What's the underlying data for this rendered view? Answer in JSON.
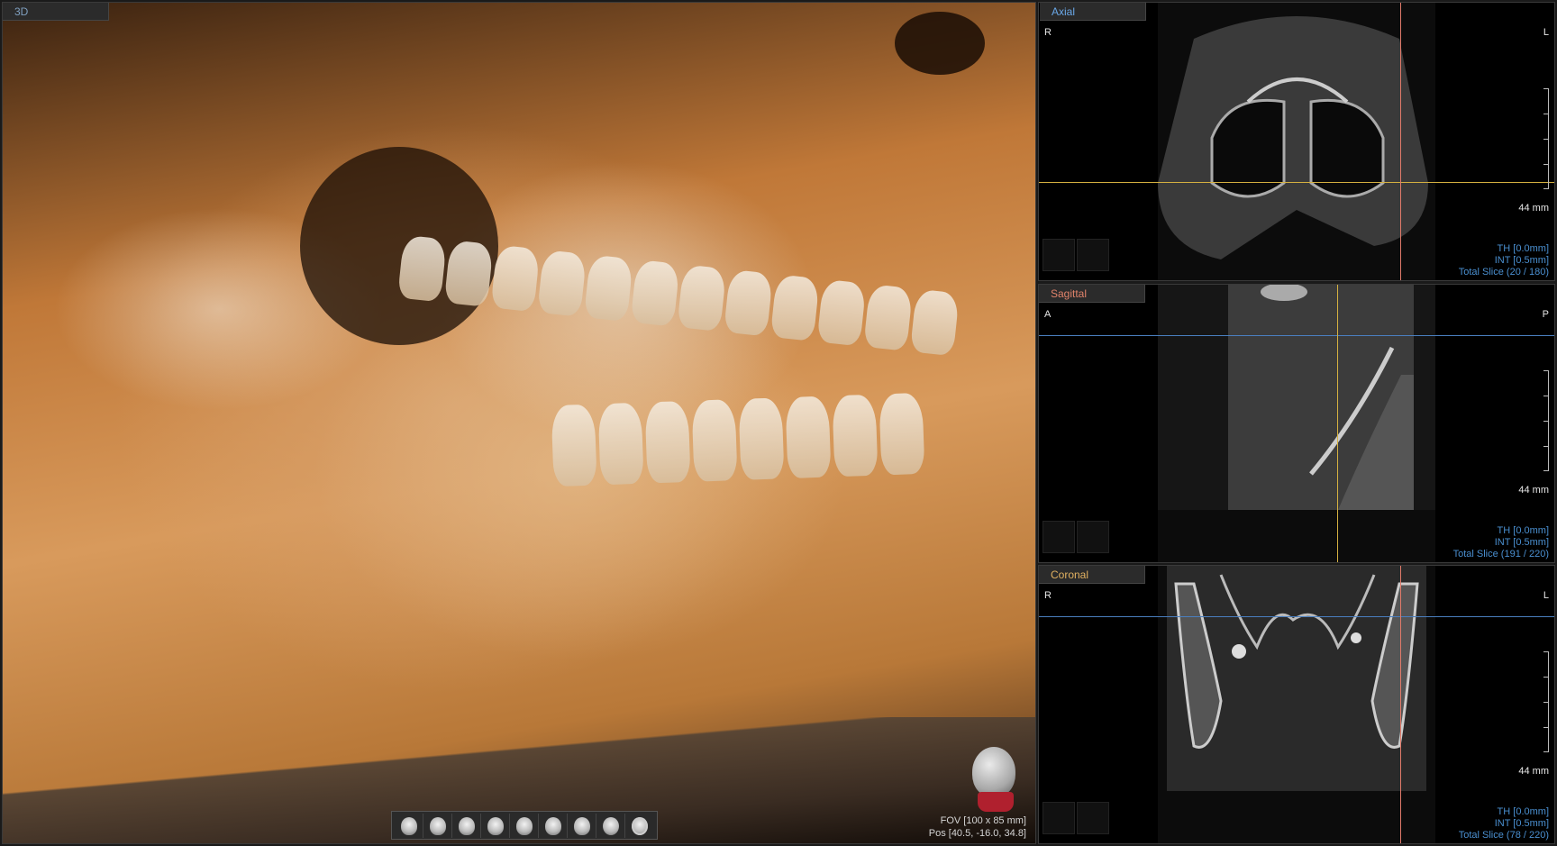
{
  "views": {
    "v3d": {
      "label": "3D",
      "fov_line": "FOV [100 x 85 mm]",
      "pos_line": "Pos [40.5, -16.0, 34.8]"
    },
    "axial": {
      "label": "Axial",
      "left": "R",
      "right": "L",
      "scale": "44 mm",
      "th": "TH [0.0mm]",
      "int": "INT [0.5mm]",
      "total": "Total Slice (20 / 180)"
    },
    "sagittal": {
      "label": "Sagittal",
      "left": "A",
      "right": "P",
      "scale": "44 mm",
      "th": "TH [0.0mm]",
      "int": "INT [0.5mm]",
      "total": "Total Slice (191 / 220)"
    },
    "coronal": {
      "label": "Coronal",
      "left": "R",
      "right": "L",
      "scale": "44 mm",
      "th": "TH [0.0mm]",
      "int": "INT [0.5mm]",
      "total": "Total Slice (78 / 220)"
    }
  },
  "toolbar": {
    "buttons": [
      "view-right-icon",
      "view-front-right-icon",
      "view-front-icon",
      "view-front-left-icon",
      "view-left-icon",
      "view-top-icon",
      "view-bottom-icon",
      "view-back-icon",
      "rotate-icon"
    ]
  },
  "colors": {
    "axial_line": "#4a7fc0",
    "sagittal_line": "#e07a6a",
    "coronal_line": "#d4b040",
    "info_text": "#4a8fd0"
  }
}
